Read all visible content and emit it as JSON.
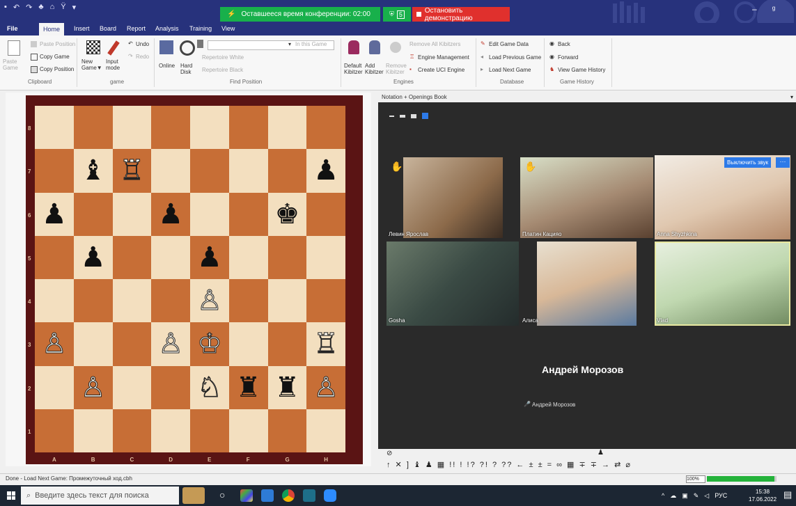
{
  "window": {
    "qat_icons": [
      "save-icon",
      "undo-icon",
      "redo-icon",
      "network-icon",
      "pin-icon",
      "chevron-down-icon"
    ],
    "conference_timer": "Оставшееся время конференции: 02:00",
    "shield_count": "5",
    "stop_demo": "Остановить демонстрацию",
    "controls": [
      "–",
      "ᵍ",
      "×"
    ]
  },
  "menu": [
    "File",
    "Home",
    "Insert",
    "Board",
    "Report",
    "Analysis",
    "Training",
    "View"
  ],
  "ribbon": {
    "clipboard": {
      "paste_game": "Paste Game",
      "paste_position": "Paste Position",
      "copy_game": "Copy Game",
      "copy_position": "Copy Position",
      "label": "Clipboard"
    },
    "game": {
      "new_game": "New Game▼",
      "input_mode": "Input mode",
      "undo": "Undo",
      "redo": "Redo",
      "label": "game"
    },
    "find": {
      "online": "Online",
      "hard_disk": "Hard Disk",
      "repertoire_white": "Repertoire White",
      "repertoire_black": "Repertoire Black",
      "in_this_game": "In this Game",
      "label": "Find Position"
    },
    "engines": {
      "default_kibitzer": "Default Kibitzer",
      "add_kibitzer": "Add Kibitzer",
      "remove_kibitzer": "Remove Kibitzer",
      "remove_all": "Remove All Kibitzers",
      "engine_management": "Engine Management",
      "create_uci": "Create UCI Engine",
      "label": "Engines"
    },
    "database": {
      "edit_game_data": "Edit Game Data",
      "load_previous": "Load Previous Game",
      "load_next": "Load Next Game",
      "label": "Database"
    },
    "history": {
      "back": "Back",
      "forward": "Forward",
      "view_history": "View Game History",
      "label": "Game History"
    }
  },
  "board": {
    "files": [
      "A",
      "B",
      "C",
      "D",
      "E",
      "F",
      "G",
      "H"
    ],
    "ranks": [
      "8",
      "7",
      "6",
      "5",
      "4",
      "3",
      "2",
      "1"
    ],
    "position": [
      [
        "",
        "",
        "",
        "",
        "",
        "",
        "",
        ""
      ],
      [
        "",
        "♝",
        "♖",
        "",
        "",
        "",
        "",
        "♟"
      ],
      [
        "♟",
        "",
        "",
        "♟",
        "",
        "",
        "♚",
        ""
      ],
      [
        "",
        "♟",
        "",
        "",
        "♟",
        "",
        "",
        ""
      ],
      [
        "",
        "",
        "",
        "",
        "♙",
        "",
        "",
        ""
      ],
      [
        "♙",
        "",
        "",
        "♙",
        "♔",
        "",
        "",
        "♖"
      ],
      [
        "",
        "♙",
        "",
        "",
        "♘",
        "♜",
        "♜",
        "♙"
      ],
      [
        "",
        "",
        "",
        "",
        "",
        "",
        "",
        ""
      ]
    ]
  },
  "notation": {
    "title": "Notation + Openings Book",
    "participants": [
      {
        "name": "Левин Ярослав",
        "hand": true
      },
      {
        "name": "Платин Кацияо",
        "hand": true
      },
      {
        "name": "Anna Shyzhkina",
        "hand": false
      },
      {
        "name": "Gosha",
        "hand": false
      },
      {
        "name": "Алиса",
        "hand": false
      },
      {
        "name": "Vlad",
        "hand": false
      }
    ],
    "mute_button": "Выключить звук",
    "more": "···",
    "presenter": "Андрей Морозов",
    "presenter_small": "Андрей Морозов"
  },
  "annotations": "↑ ✕ ] ♝ ♟ ▦ !! ! !? ?! ? ?? ← ± ± = ∞ ▦ ∓ ∓ → ⇄ ⌀",
  "status": {
    "text": "Done - Load Next Game: Промежуточный ход.cbh",
    "zoom": "100%",
    "progress": 0.97
  },
  "taskbar": {
    "search_placeholder": "Введите здесь текст для поиска",
    "lang": "РУС",
    "time": "15:38",
    "date": "17.06.2022"
  },
  "colors": {
    "title_bg": "#27327c",
    "accent_green": "#18b04b",
    "stop_red": "#e0302d",
    "board_dark": "#c76e36",
    "board_light": "#f3dfbf",
    "mute_blue": "#2d7ae8"
  }
}
